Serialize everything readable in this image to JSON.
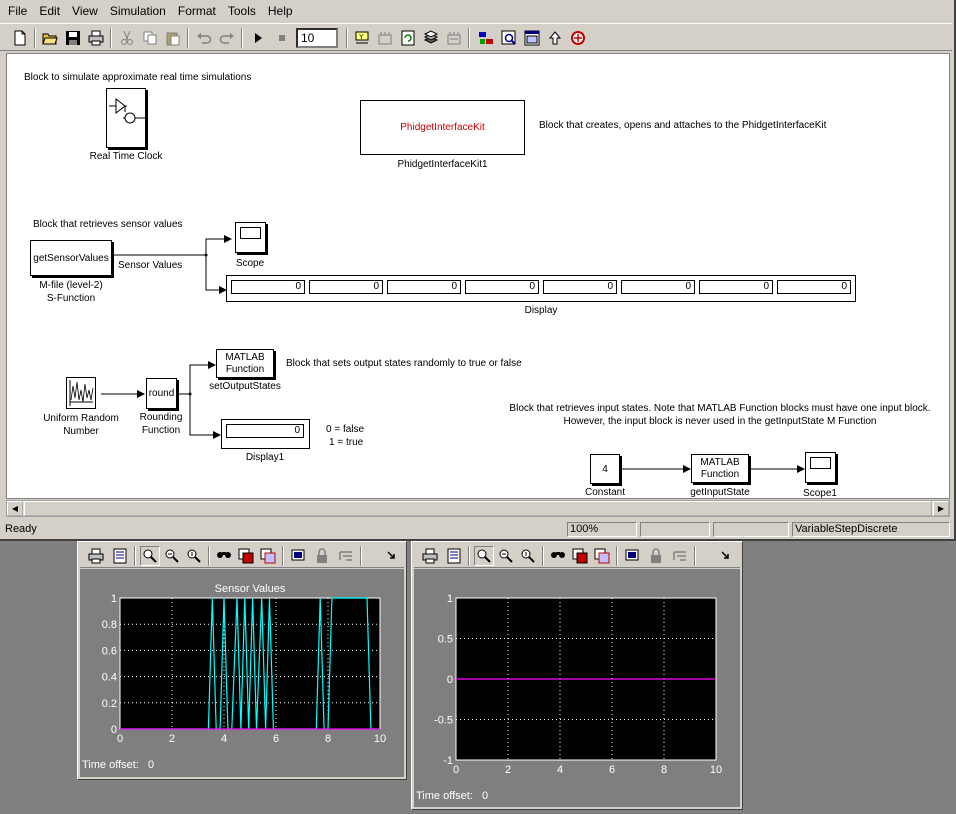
{
  "menu": [
    "File",
    "Edit",
    "View",
    "Simulation",
    "Format",
    "Tools",
    "Help"
  ],
  "toolbar": {
    "stop_time": "10",
    "icons": [
      "new-file-icon",
      "open-folder-icon",
      "save-icon",
      "print-icon",
      "cut-icon",
      "copy-icon",
      "paste-icon",
      "undo-icon",
      "redo-icon",
      "start-simulation-icon",
      "stop-simulation-icon",
      "normal-mode-icon",
      "build-icon",
      "update-diagram-icon",
      "library-browser-icon",
      "model-explorer-icon",
      "model-browser-icon",
      "debugger-icon",
      "go-to-parent-icon",
      "debug-icon"
    ]
  },
  "diagram": {
    "rt_clock": {
      "comment": "Block to simulate approximate real time simulations",
      "name": "Real Time Clock"
    },
    "phidget": {
      "text": "PhidgetInterfaceKit",
      "name": "PhidgetInterfaceKit1",
      "comment": "Block that creates, opens and attaches to the PhidgetInterfaceKit",
      "text_color": "#cc0000"
    },
    "sensor": {
      "comment": "Block that retrieves sensor values",
      "block_text": "getSensorValues",
      "name_line1": "M-file (level-2)",
      "name_line2": "S-Function",
      "signal_label": "Sensor Values"
    },
    "scope": {
      "name": "Scope"
    },
    "display": {
      "name": "Display",
      "values": [
        "0",
        "0",
        "0",
        "0",
        "0",
        "0",
        "0",
        "0"
      ]
    },
    "uniform_random": {
      "name_line1": "Uniform Random",
      "name_line2": "Number"
    },
    "rounding": {
      "block_text": "round",
      "name_line1": "Rounding",
      "name_line2": "Function"
    },
    "set_output": {
      "block_line1": "MATLAB",
      "block_line2": "Function",
      "name": "setOutputStates",
      "comment": "Block that sets output states randomly to true or false"
    },
    "display1": {
      "name": "Display1",
      "value": "0",
      "note_line1": "0 = false",
      "note_line2": "1 = true"
    },
    "input_comment": {
      "line1": "Block that retrieves input states. Note that MATLAB Function blocks must have one input block.",
      "line2": "However, the input block is never used in the getInputState M Function"
    },
    "constant": {
      "value": "4",
      "name": "Constant"
    },
    "get_input": {
      "block_line1": "MATLAB",
      "block_line2": "Function",
      "name": "getInputState"
    },
    "scope1": {
      "name": "Scope1"
    }
  },
  "status": {
    "ready": "Ready",
    "zoom": "100%",
    "solver": "VariableStepDiscrete"
  },
  "scope_toolbar_icons": [
    "print-icon",
    "parameters-icon",
    "zoom-icon",
    "zoom-x-icon",
    "zoom-y-icon",
    "autoscale-icon",
    "save-axes-icon",
    "restore-axes-icon",
    "floating-scope-icon",
    "lock-axes-icon",
    "signal-selector-icon",
    "dock-arrow-icon"
  ],
  "scope_left": {
    "title": "Sensor Values",
    "time_offset_label": "Time offset:",
    "time_offset_value": "0"
  },
  "scope_right": {
    "title": "",
    "time_offset_label": "Time offset:",
    "time_offset_value": "0"
  },
  "chart_data": [
    {
      "type": "line",
      "title": "Sensor Values",
      "xlabel": "",
      "ylabel": "",
      "xlim": [
        0,
        10
      ],
      "ylim": [
        0,
        1
      ],
      "xticks": [
        "0",
        "2",
        "4",
        "6",
        "8",
        "10"
      ],
      "yticks": [
        "0",
        "0.2",
        "0.4",
        "0.6",
        "0.8",
        "1"
      ],
      "grid": true,
      "background": "#000000",
      "series": [
        {
          "color": "#00ffff",
          "x": [
            0,
            3.4,
            3.55,
            3.7,
            3.85,
            4.0,
            4.15,
            4.3,
            4.5,
            4.65,
            4.8,
            4.95,
            5.1,
            5.25,
            5.45,
            5.6,
            5.75,
            5.9,
            7.55,
            7.7,
            7.85,
            8.0,
            8.15,
            9.5,
            9.65,
            10
          ],
          "y": [
            0,
            0,
            1,
            0,
            0,
            1,
            0,
            0,
            1,
            0,
            1,
            0,
            1,
            0,
            1,
            0,
            1,
            0,
            0,
            1,
            0,
            0,
            1,
            1,
            0,
            0
          ]
        },
        {
          "color": "#ff00ff",
          "x": [
            0,
            10
          ],
          "y": [
            0,
            0
          ]
        }
      ]
    },
    {
      "type": "line",
      "title": "",
      "xlabel": "",
      "ylabel": "",
      "xlim": [
        0,
        10
      ],
      "ylim": [
        -1,
        1
      ],
      "xticks": [
        "0",
        "2",
        "4",
        "6",
        "8",
        "10"
      ],
      "yticks": [
        "-1",
        "-0.5",
        "0",
        "0.5",
        "1"
      ],
      "grid": true,
      "background": "#000000",
      "series": [
        {
          "color": "#ff00ff",
          "x": [
            0,
            10
          ],
          "y": [
            0,
            0
          ]
        }
      ]
    }
  ]
}
